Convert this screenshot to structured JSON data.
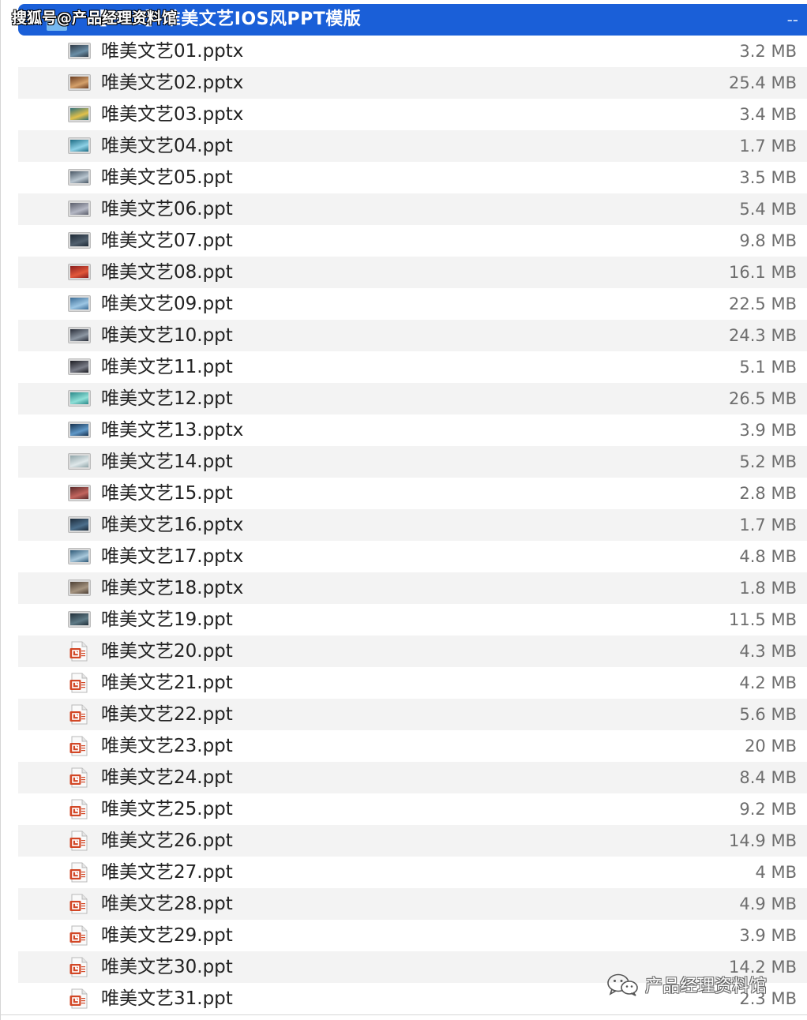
{
  "watermark_top": "搜狐号@产品经理资料馆",
  "folder": {
    "title": "【PPT】唯美文艺IOS风PPT模版",
    "size": "--",
    "icon": "folder-icon"
  },
  "files": [
    {
      "name": "唯美文艺01.pptx",
      "size": "3.2 MB",
      "icon": "slide-thumbnail-icon",
      "thumb": [
        "#2f3a45",
        "#6a8ea6"
      ]
    },
    {
      "name": "唯美文艺02.pptx",
      "size": "25.4 MB",
      "icon": "slide-thumbnail-icon",
      "thumb": [
        "#6b3d22",
        "#d5a06a"
      ]
    },
    {
      "name": "唯美文艺03.pptx",
      "size": "3.4 MB",
      "icon": "slide-thumbnail-icon",
      "thumb": [
        "#2c6f7a",
        "#e2c14a"
      ]
    },
    {
      "name": "唯美文艺04.ppt",
      "size": "1.7 MB",
      "icon": "slide-thumbnail-icon",
      "thumb": [
        "#1e6d85",
        "#8ed1e6"
      ]
    },
    {
      "name": "唯美文艺05.ppt",
      "size": "3.5 MB",
      "icon": "slide-thumbnail-icon",
      "thumb": [
        "#4a5866",
        "#b9c6d0"
      ]
    },
    {
      "name": "唯美文艺06.ppt",
      "size": "5.4 MB",
      "icon": "slide-thumbnail-icon",
      "thumb": [
        "#5b5e6b",
        "#b4b7c4"
      ]
    },
    {
      "name": "唯美文艺07.ppt",
      "size": "9.8 MB",
      "icon": "slide-thumbnail-icon",
      "thumb": [
        "#1f2a36",
        "#51606e"
      ]
    },
    {
      "name": "唯美文艺08.ppt",
      "size": "16.1 MB",
      "icon": "slide-thumbnail-icon",
      "thumb": [
        "#8a1e1e",
        "#e2583a"
      ]
    },
    {
      "name": "唯美文艺09.ppt",
      "size": "22.5 MB",
      "icon": "slide-thumbnail-icon",
      "thumb": [
        "#3a6c96",
        "#9cc6e4"
      ]
    },
    {
      "name": "唯美文艺10.ppt",
      "size": "24.3 MB",
      "icon": "slide-thumbnail-icon",
      "thumb": [
        "#2a2f3a",
        "#8d97a3"
      ]
    },
    {
      "name": "唯美文艺11.ppt",
      "size": "5.1 MB",
      "icon": "slide-thumbnail-icon",
      "thumb": [
        "#1c1c22",
        "#7a7d88"
      ]
    },
    {
      "name": "唯美文艺12.ppt",
      "size": "26.5 MB",
      "icon": "slide-thumbnail-icon",
      "thumb": [
        "#2b8a8a",
        "#8ee0d8"
      ]
    },
    {
      "name": "唯美文艺13.pptx",
      "size": "3.9 MB",
      "icon": "slide-thumbnail-icon",
      "thumb": [
        "#17324f",
        "#5f98c8"
      ]
    },
    {
      "name": "唯美文艺14.ppt",
      "size": "5.2 MB",
      "icon": "slide-thumbnail-icon",
      "thumb": [
        "#8fa4a8",
        "#dfe8ea"
      ]
    },
    {
      "name": "唯美文艺15.ppt",
      "size": "2.8 MB",
      "icon": "slide-thumbnail-icon",
      "thumb": [
        "#5a2a2a",
        "#c2655e"
      ]
    },
    {
      "name": "唯美文艺16.pptx",
      "size": "1.7 MB",
      "icon": "slide-thumbnail-icon",
      "thumb": [
        "#1d2c3b",
        "#4c6f8c"
      ]
    },
    {
      "name": "唯美文艺17.pptx",
      "size": "4.8 MB",
      "icon": "slide-thumbnail-icon",
      "thumb": [
        "#2f5a78",
        "#a9c9dc"
      ]
    },
    {
      "name": "唯美文艺18.pptx",
      "size": "1.8 MB",
      "icon": "slide-thumbnail-icon",
      "thumb": [
        "#4d4035",
        "#a59480"
      ]
    },
    {
      "name": "唯美文艺19.ppt",
      "size": "11.5 MB",
      "icon": "slide-thumbnail-icon",
      "thumb": [
        "#22303a",
        "#5e7a86"
      ]
    },
    {
      "name": "唯美文艺20.ppt",
      "size": "4.3 MB",
      "icon": "powerpoint-file-icon"
    },
    {
      "name": "唯美文艺21.ppt",
      "size": "4.2 MB",
      "icon": "powerpoint-file-icon"
    },
    {
      "name": "唯美文艺22.ppt",
      "size": "5.6 MB",
      "icon": "powerpoint-file-icon"
    },
    {
      "name": "唯美文艺23.ppt",
      "size": "20 MB",
      "icon": "powerpoint-file-icon"
    },
    {
      "name": "唯美文艺24.ppt",
      "size": "8.4 MB",
      "icon": "powerpoint-file-icon"
    },
    {
      "name": "唯美文艺25.ppt",
      "size": "9.2 MB",
      "icon": "powerpoint-file-icon"
    },
    {
      "name": "唯美文艺26.ppt",
      "size": "14.9 MB",
      "icon": "powerpoint-file-icon"
    },
    {
      "name": "唯美文艺27.ppt",
      "size": "4 MB",
      "icon": "powerpoint-file-icon"
    },
    {
      "name": "唯美文艺28.ppt",
      "size": "4.9 MB",
      "icon": "powerpoint-file-icon"
    },
    {
      "name": "唯美文艺29.ppt",
      "size": "3.9 MB",
      "icon": "powerpoint-file-icon"
    },
    {
      "name": "唯美文艺30.ppt",
      "size": "14.2 MB",
      "icon": "powerpoint-file-icon"
    },
    {
      "name": "唯美文艺31.ppt",
      "size": "2.3 MB",
      "icon": "powerpoint-file-icon"
    }
  ],
  "watermark_bottom": {
    "text": "产品经理资料馆",
    "icon": "wechat-icon"
  },
  "colors": {
    "selection": "#1a5fd8",
    "stripe": "#f3f3f3",
    "ppt_red": "#d24726"
  }
}
